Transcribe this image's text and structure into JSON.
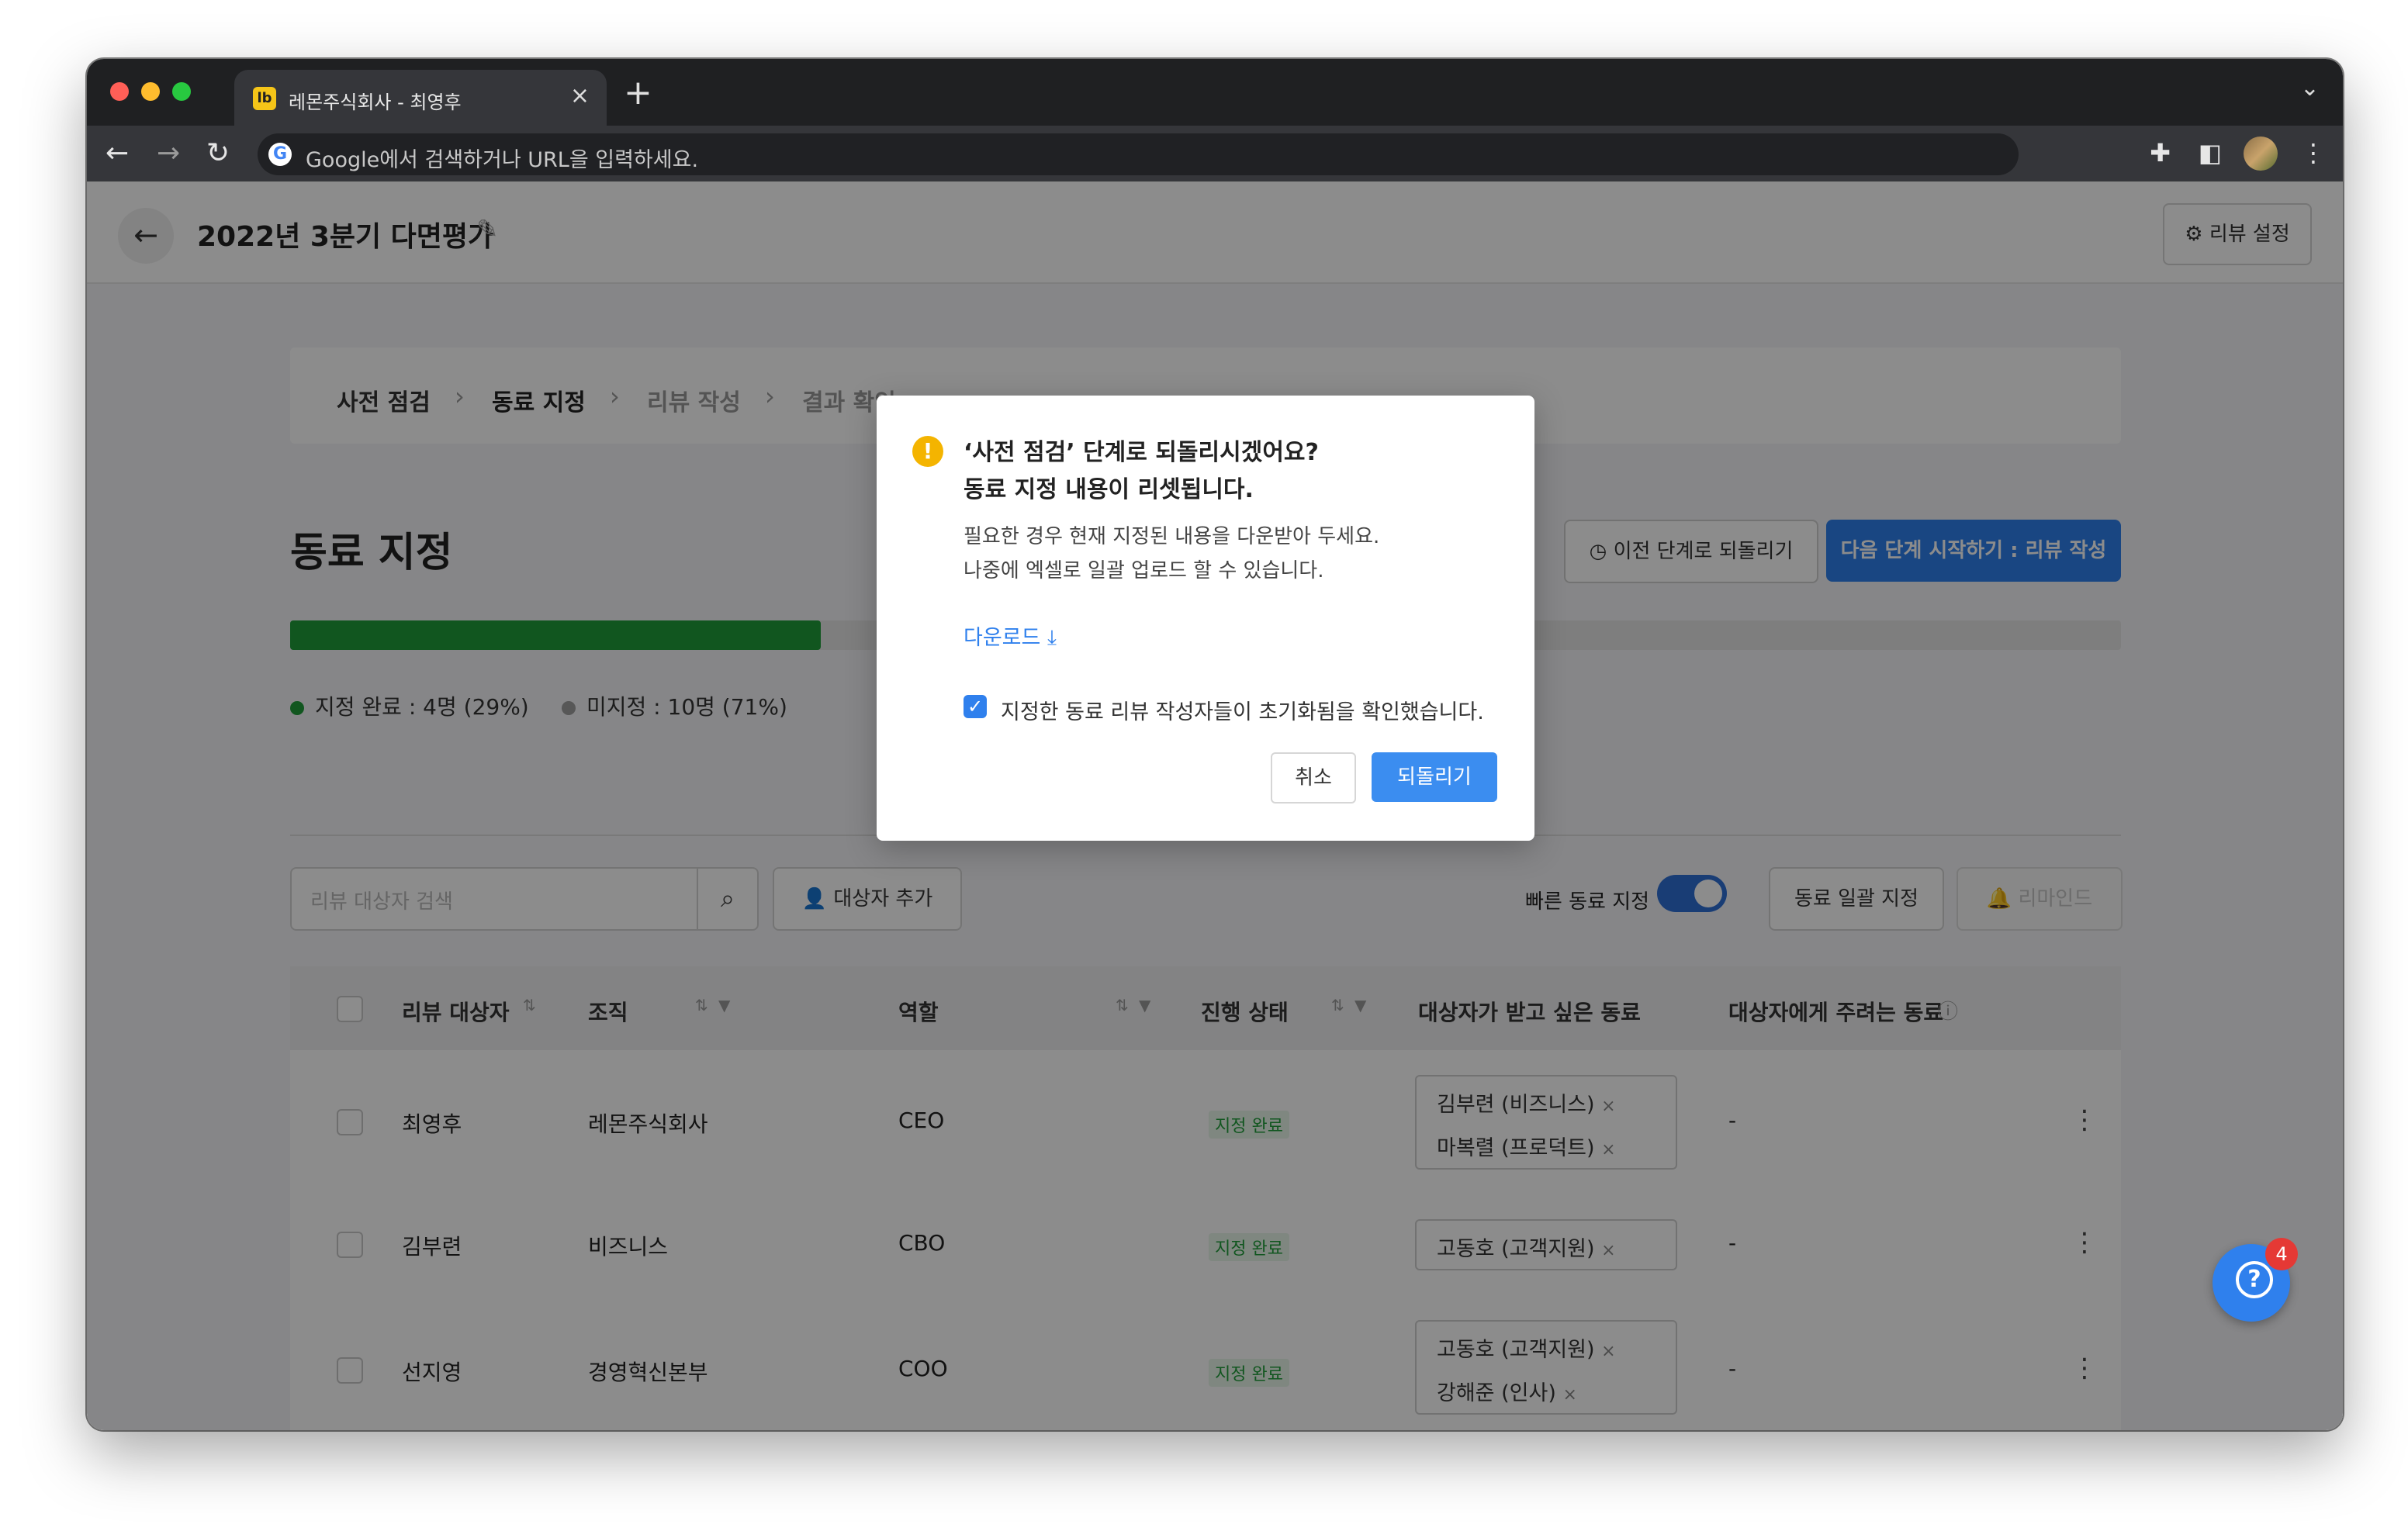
{
  "browser": {
    "tab_title": "레몬주식회사 - 최영후",
    "favicon_text": "lb",
    "omnibox_placeholder": "Google에서 검색하거나 URL을 입력하세요."
  },
  "header": {
    "title": "2022년 3분기 다면평가",
    "review_settings_label": "리뷰 설정"
  },
  "steps": [
    {
      "label": "사전 점검",
      "state": "done"
    },
    {
      "label": "동료 지정",
      "state": "current"
    },
    {
      "label": "리뷰 작성",
      "state": "upcoming"
    },
    {
      "label": "결과 확인",
      "state": "upcoming"
    }
  ],
  "section": {
    "title": "동료 지정",
    "prev_button": "이전 단계로 되돌리기",
    "next_button": "다음 단계 시작하기 : 리뷰 작성"
  },
  "progress": {
    "fraction": 0.29,
    "done_label": "지정 완료 : 4명 (29%)",
    "pending_label": "미지정 : 10명 (71%)",
    "done_color": "#1f9d3a",
    "pending_color": "#9e9e9e"
  },
  "controls": {
    "search_placeholder": "리뷰 대상자 검색",
    "add_target": "대상자 추가",
    "quick_assign": "빠른 동료 지정",
    "quick_assign_on": true,
    "bulk_assign": "동료 일괄 지정",
    "remind": "리마인드"
  },
  "table": {
    "headers": [
      "리뷰 대상자",
      "조직",
      "역할",
      "진행 상태",
      "대상자가 받고 싶은 동료",
      "대상자에게 주려는 동료"
    ],
    "rows": [
      {
        "name": "최영후",
        "org": "레몬주식회사",
        "role": "CEO",
        "status": "지정 완료",
        "peers": [
          "김부련 (비즈니스)",
          "마복렬 (프로덕트)"
        ],
        "giving": "-"
      },
      {
        "name": "김부련",
        "org": "비즈니스",
        "role": "CBO",
        "status": "지정 완료",
        "peers": [
          "고동호 (고객지원)"
        ],
        "giving": "-"
      },
      {
        "name": "선지영",
        "org": "경영혁신본부",
        "role": "COO",
        "status": "지정 완료",
        "peers": [
          "고동호 (고객지원)",
          "강해준 (인사)"
        ],
        "giving": "-"
      }
    ]
  },
  "modal": {
    "title_line1": "‘사전 점검’ 단계로 되돌리시겠어요?",
    "title_line2": "동료 지정 내용이 리셋됩니다.",
    "body_line1": "필요한 경우 현재 지정된 내용을 다운받아 두세요.",
    "body_line2": "나중에 엑셀로 일괄 업로드 할 수 있습니다.",
    "download_label": "다운로드",
    "confirm_text": "지정한 동료 리뷰 작성자들이 초기화됨을 확인했습니다.",
    "confirm_checked": true,
    "cancel_label": "취소",
    "revert_label": "되돌리기"
  },
  "help": {
    "badge_count": "4"
  }
}
